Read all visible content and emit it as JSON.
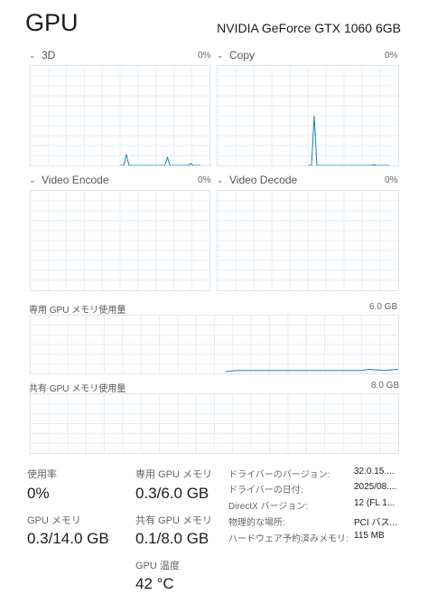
{
  "header": {
    "title": "GPU",
    "model": "NVIDIA GeForce GTX 1060 6GB"
  },
  "engines": [
    {
      "name": "3D",
      "value": "0%"
    },
    {
      "name": "Copy",
      "value": "0%"
    },
    {
      "name": "Video Encode",
      "value": "0%"
    },
    {
      "name": "Video Decode",
      "value": "0%"
    }
  ],
  "memory": {
    "dedicated_label": "専用 GPU メモリ使用量",
    "dedicated_max": "6.0 GB",
    "shared_label": "共有 GPU メモリ使用量",
    "shared_max": "8.0 GB"
  },
  "stats": {
    "utilization_label": "使用率",
    "utilization_value": "0%",
    "gpu_memory_label": "GPU メモリ",
    "gpu_memory_value": "0.3/14.0 GB",
    "dedicated_label": "専用 GPU メモリ",
    "dedicated_value": "0.3/6.0 GB",
    "shared_label": "共有 GPU メモリ",
    "shared_value": "0.1/8.0 GB",
    "temp_label": "GPU 温度",
    "temp_value": "42 °C"
  },
  "properties": [
    {
      "name": "ドライバーのバージョン:",
      "value": "32.0.15...."
    },
    {
      "name": "ドライバーの日付:",
      "value": "2025/08...."
    },
    {
      "name": "DirectX バージョン:",
      "value": "12 (FL 1..."
    },
    {
      "name": "物理的な場所:",
      "value": "PCI バス..."
    },
    {
      "name": "ハードウェア予約済みメモリ:",
      "value": "115 MB"
    }
  ],
  "colors": {
    "line": "#1a7fb5",
    "grid": "#e3ecf4",
    "border": "#d9e6f2"
  }
}
